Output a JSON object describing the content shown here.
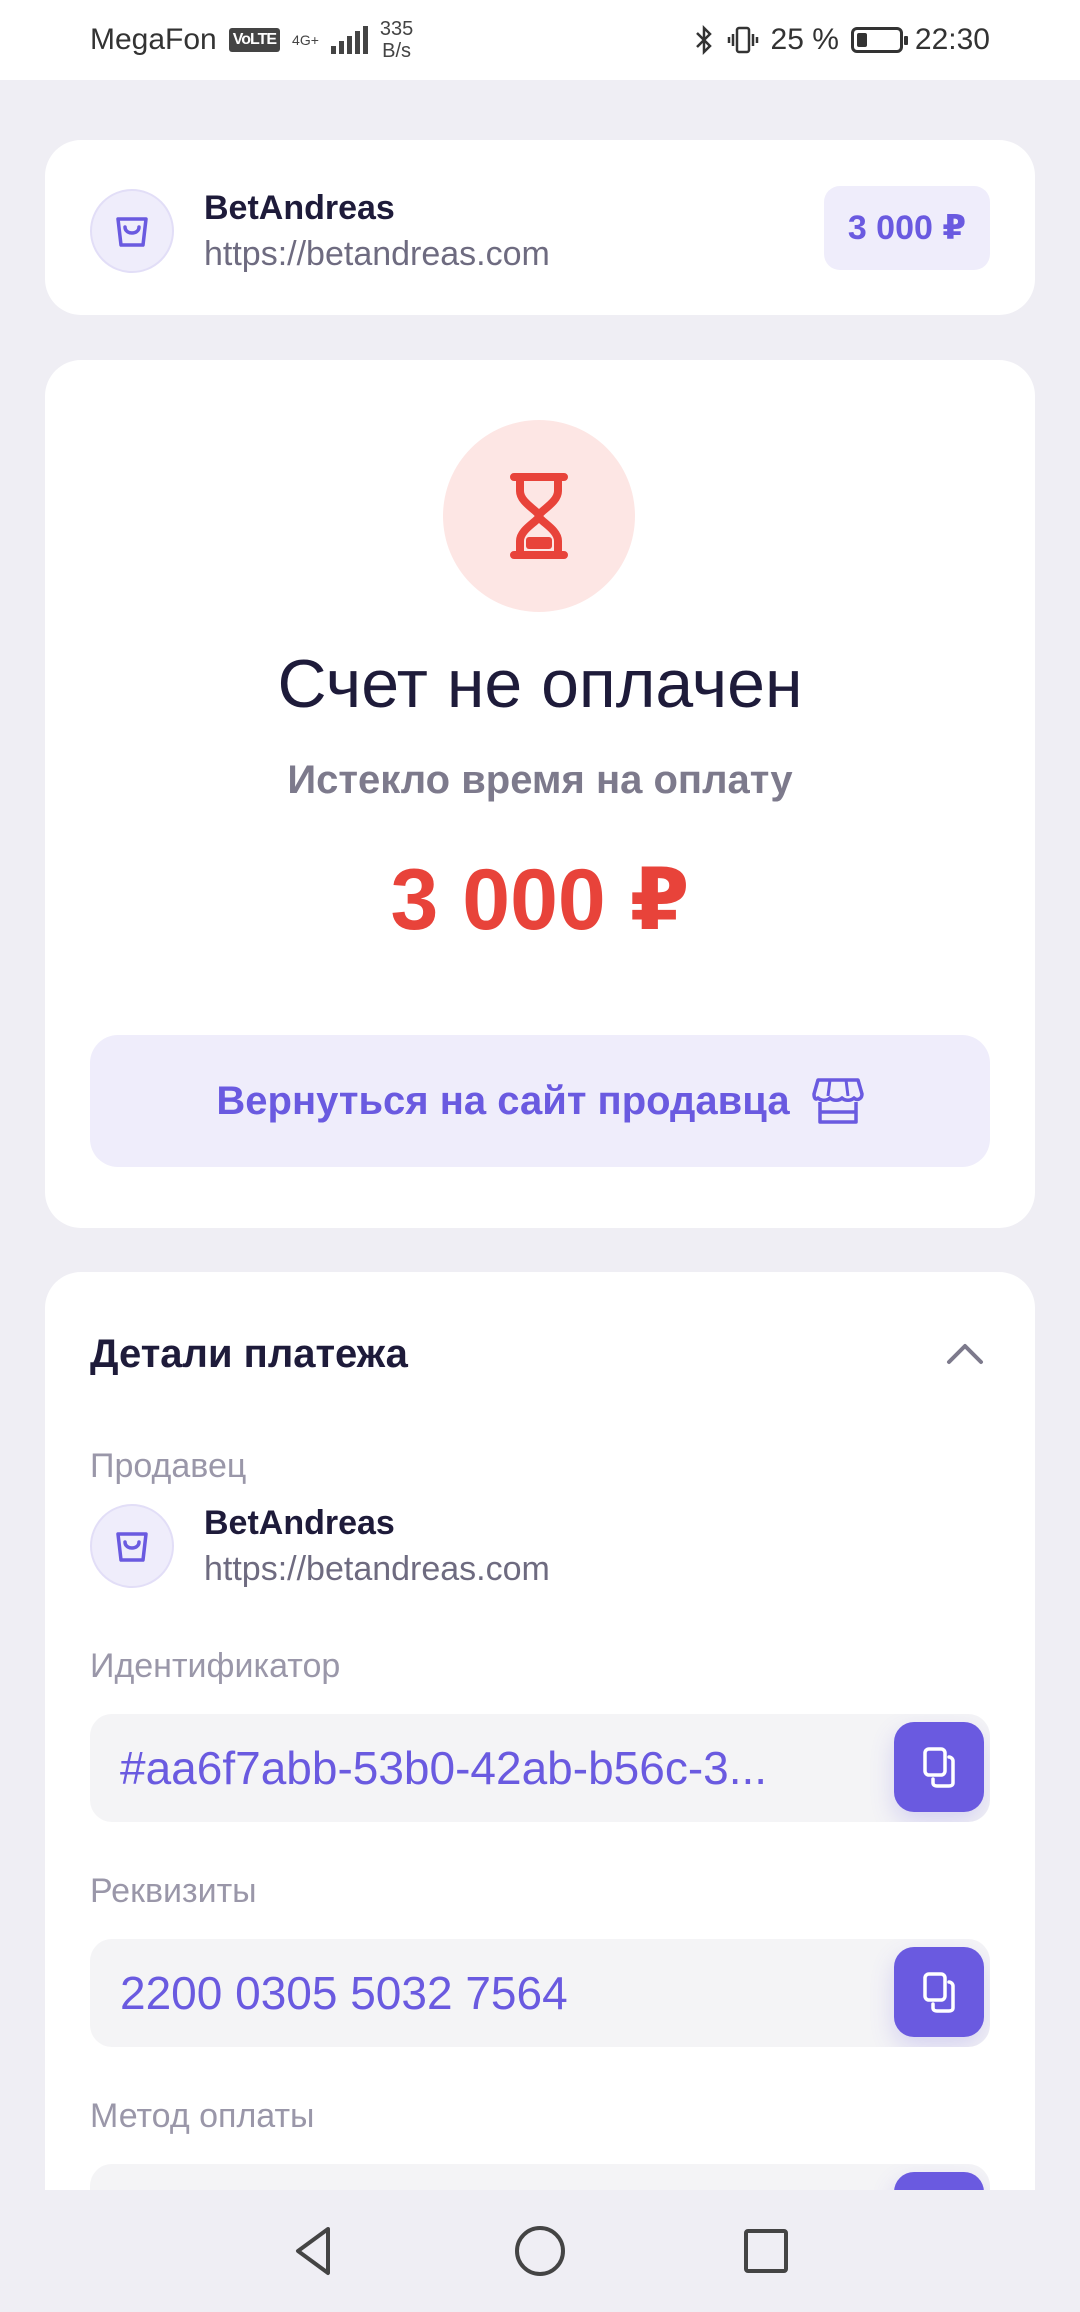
{
  "status_bar": {
    "carrier": "MegaFon",
    "volte": "VoLTE",
    "network": "4G+",
    "speed_value": "335",
    "speed_unit": "B/s",
    "battery": "25 %",
    "time": "22:30",
    "battery_level": 0.25
  },
  "merchant": {
    "name": "BetAndreas",
    "url": "https://betandreas.com",
    "amount": "3 000 ₽"
  },
  "status": {
    "title": "Счет не оплачен",
    "subtitle": "Истекло время на оплату",
    "amount": "3 000 ₽",
    "return_button": "Вернуться на сайт продавца"
  },
  "details": {
    "title": "Детали платежа",
    "seller_label": "Продавец",
    "seller_name": "BetAndreas",
    "seller_url": "https://betandreas.com",
    "id_label": "Идентификатор",
    "id_value": "#aa6f7abb-53b0-42ab-b56c-3...",
    "requisites_label": "Реквизиты",
    "requisites_value": "2200 0305 5032 7564",
    "method_label": "Метод оплаты"
  },
  "colors": {
    "accent": "#6a5ae0",
    "danger": "#e8433a",
    "background": "#efeef4"
  }
}
